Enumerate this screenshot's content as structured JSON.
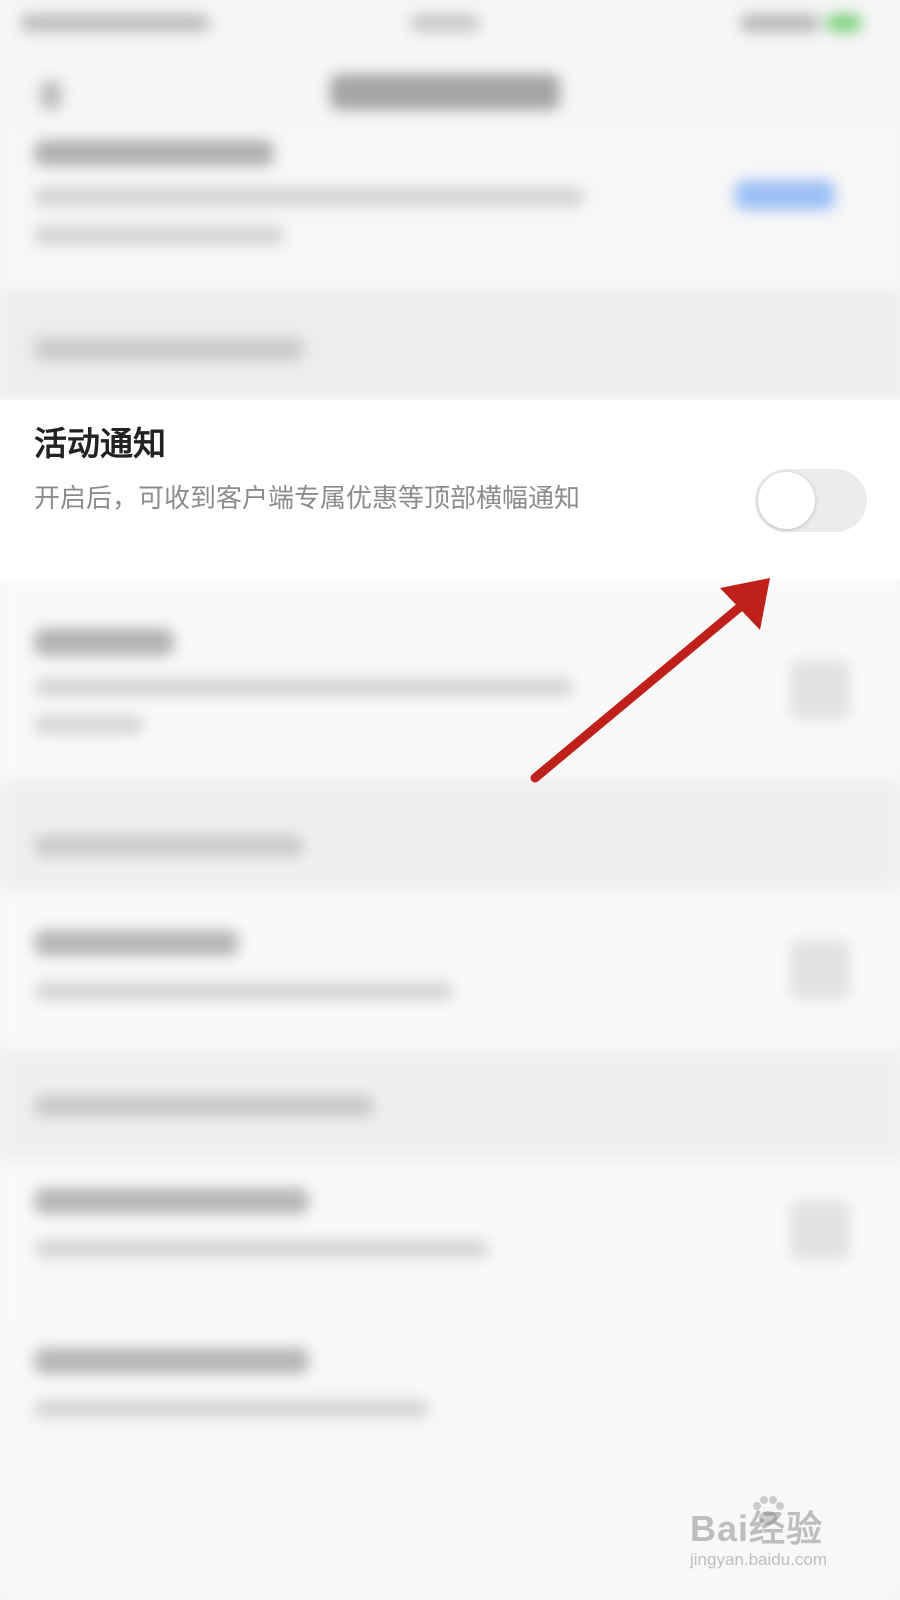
{
  "notification_item": {
    "title": "活动通知",
    "description": "开启后，可收到客户端专属优惠等顶部横幅通知",
    "toggle_state": "off"
  },
  "annotation": {
    "arrow_color": "#c0201a"
  },
  "watermark": {
    "logo": "Bai经验",
    "url": "jingyan.baidu.com"
  },
  "colors": {
    "background": "#f4f4f4",
    "accent_blurred": "#4b8bf5",
    "title_text": "#222222",
    "desc_text": "#8c8c8c"
  }
}
